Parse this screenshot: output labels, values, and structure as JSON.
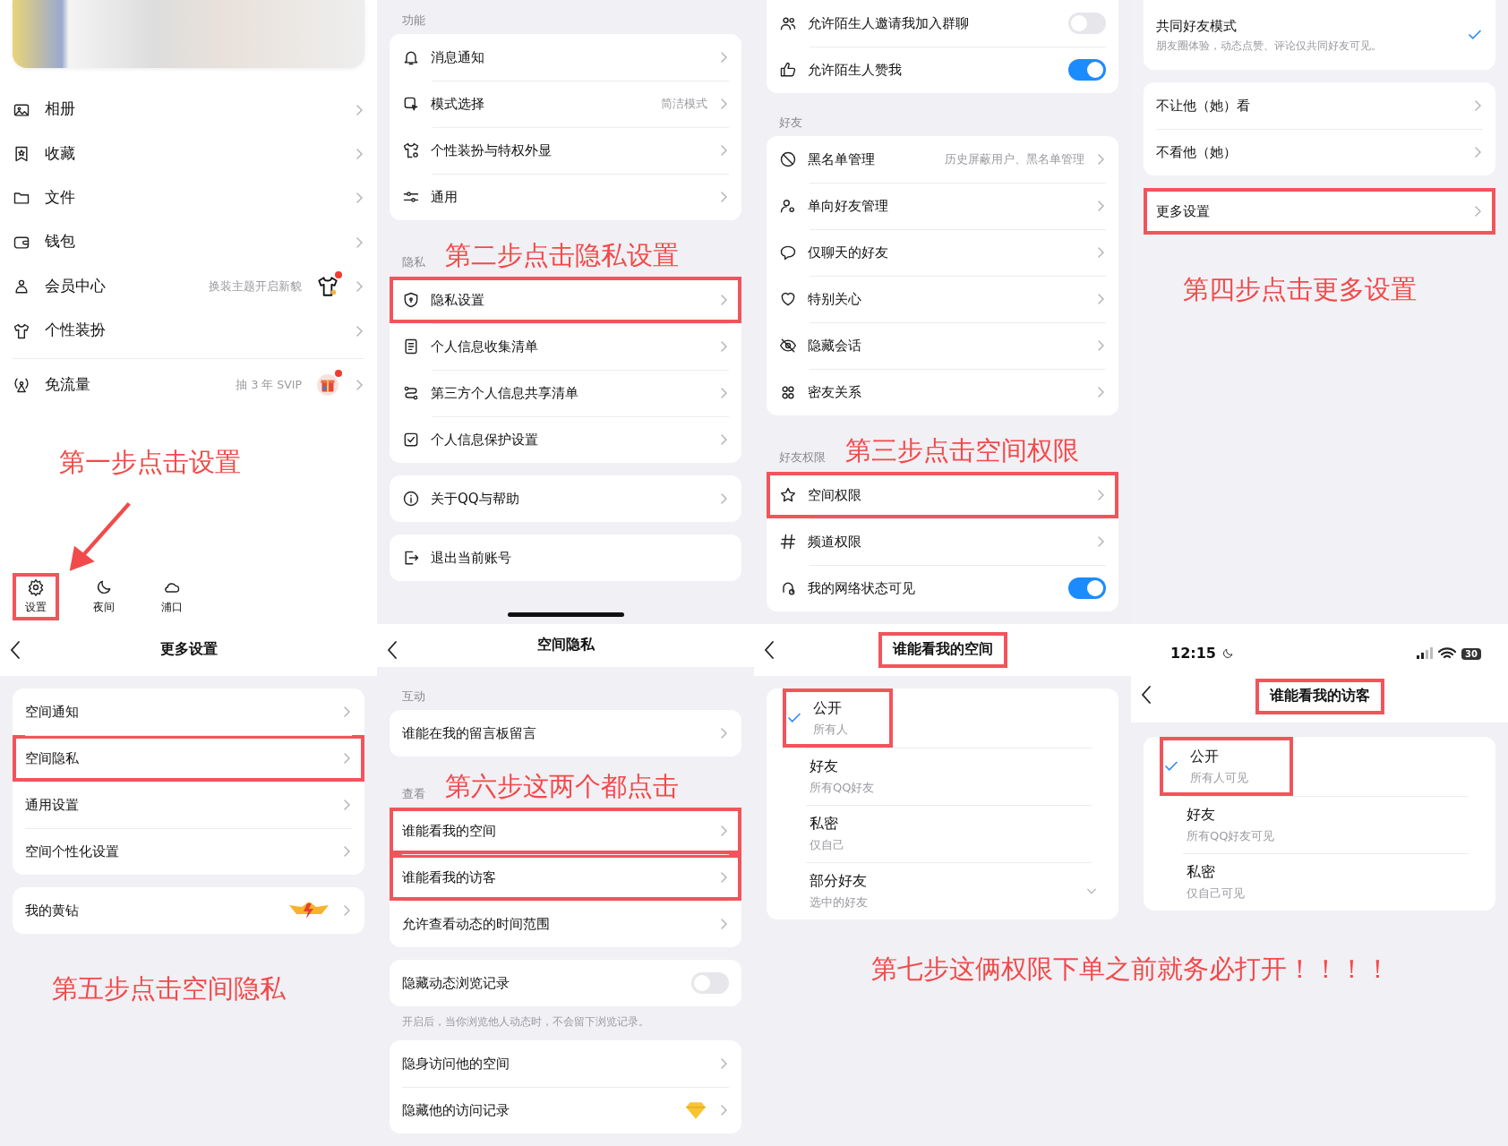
{
  "panels": [
    {
      "blocks": [
        {
          "kind": "profile"
        },
        {
          "kind": "menu",
          "items": [
            {
              "label": "相册"
            },
            {
              "label": "收藏"
            },
            {
              "label": "文件"
            },
            {
              "label": "钱包"
            },
            {
              "label": "会员中心",
              "value": "换装主题开启新貌",
              "badge": true,
              "notify": true
            },
            {
              "label": "个性装扮"
            },
            {
              "label": "免流量",
              "value": "抽 3 年 SVIP",
              "badge": true,
              "notify": true,
              "divider_before": true
            }
          ]
        },
        {
          "kind": "annotation",
          "text": "第一步点击设置",
          "arrow": true
        },
        {
          "kind": "bottom_bar",
          "items": [
            {
              "label": "设置",
              "highlighted": true
            },
            {
              "label": "夜间",
              "highlighted": false
            },
            {
              "label": "浦口",
              "highlighted": false
            }
          ]
        }
      ]
    },
    {
      "blocks": [
        {
          "kind": "section_label",
          "text": "功能"
        },
        {
          "kind": "card",
          "items": [
            {
              "label": "消息通知",
              "kind": "chevron"
            },
            {
              "label": "模式选择",
              "value": "简洁模式",
              "kind": "chevron"
            },
            {
              "label": "个性装扮与特权外显",
              "kind": "chevron"
            },
            {
              "label": "通用",
              "kind": "chevron"
            }
          ]
        },
        {
          "kind": "section_label",
          "text": "隐私",
          "annotation": "第二步点击隐私设置"
        },
        {
          "kind": "card",
          "items": [
            {
              "label": "隐私设置",
              "kind": "chevron",
              "highlighted": true
            },
            {
              "label": "个人信息收集清单",
              "kind": "chevron",
              "highlighted": false
            },
            {
              "label": "第三方个人信息共享清单",
              "kind": "chevron",
              "highlighted": false
            },
            {
              "label": "个人信息保护设置",
              "kind": "chevron",
              "highlighted": false
            }
          ]
        },
        {
          "kind": "card",
          "items": [
            {
              "label": "关于QQ与帮助",
              "kind": "chevron"
            }
          ]
        },
        {
          "kind": "card",
          "items": [
            {
              "label": "退出当前账号",
              "kind": "plain"
            }
          ]
        },
        {
          "kind": "home_indicator"
        }
      ]
    },
    {
      "blocks": [
        {
          "kind": "card",
          "items": [
            {
              "label": "允许陌生人邀请我加入群聊",
              "kind": "toggle",
              "on": false
            },
            {
              "label": "允许陌生人赞我",
              "kind": "toggle",
              "on": true
            }
          ]
        },
        {
          "kind": "section_label",
          "text": "好友"
        },
        {
          "kind": "card",
          "items": [
            {
              "label": "黑名单管理",
              "value": "历史屏蔽用户、黑名单管理",
              "kind": "chevron"
            },
            {
              "label": "单向好友管理",
              "kind": "chevron"
            },
            {
              "label": "仅聊天的好友",
              "kind": "chevron"
            },
            {
              "label": "特别关心",
              "kind": "chevron"
            },
            {
              "label": "隐藏会话",
              "kind": "chevron"
            },
            {
              "label": "密友关系",
              "kind": "chevron"
            }
          ]
        },
        {
          "kind": "section_label",
          "text": "好友权限",
          "annotation": "第三步点击空间权限"
        },
        {
          "kind": "card",
          "items": [
            {
              "label": "空间权限",
              "kind": "chevron",
              "highlighted": true
            },
            {
              "label": "频道权限",
              "kind": "chevron",
              "highlighted": false
            },
            {
              "label": "我的网络状态可见",
              "kind": "toggle",
              "on": true,
              "highlighted": false
            }
          ]
        }
      ]
    },
    {
      "blocks": [
        {
          "kind": "card",
          "items": [
            {
              "label": "共同好友模式",
              "subtitle": "朋友圈体验，动态点赞、评论仅共同好友可见。",
              "kind": "check",
              "selected": true
            }
          ]
        },
        {
          "kind": "card",
          "items": [
            {
              "label": "不让他（她）看",
              "kind": "chevron"
            },
            {
              "label": "不看他（她）",
              "kind": "chevron"
            }
          ]
        },
        {
          "kind": "card",
          "items": [
            {
              "label": "更多设置",
              "kind": "chevron",
              "highlighted": true
            }
          ]
        },
        {
          "kind": "annotation",
          "text": "第四步点击更多设置"
        }
      ]
    },
    {
      "blocks": [
        {
          "kind": "nav",
          "title": "更多设置"
        },
        {
          "kind": "card",
          "items": [
            {
              "label": "空间通知",
              "kind": "chevron",
              "highlighted": false
            },
            {
              "label": "空间隐私",
              "kind": "chevron",
              "highlighted": true
            },
            {
              "label": "通用设置",
              "kind": "chevron",
              "highlighted": false
            },
            {
              "label": "空间个性化设置",
              "kind": "chevron",
              "highlighted": false
            }
          ]
        },
        {
          "kind": "card",
          "items": [
            {
              "label": "我的黄钻",
              "badge": true,
              "kind": "chevron"
            }
          ]
        },
        {
          "kind": "annotation",
          "text": "第五步点击空间隐私"
        }
      ]
    },
    {
      "blocks": [
        {
          "kind": "nav",
          "title": "空间隐私"
        },
        {
          "kind": "section_label",
          "text": "互动"
        },
        {
          "kind": "card",
          "items": [
            {
              "label": "谁能在我的留言板留言",
              "kind": "chevron"
            }
          ]
        },
        {
          "kind": "section_label",
          "text": "查看",
          "annotation": "第六步这两个都点击"
        },
        {
          "kind": "card",
          "items": [
            {
              "label": "谁能看我的空间",
              "kind": "chevron",
              "highlighted": true
            },
            {
              "label": "谁能看我的访客",
              "kind": "chevron",
              "highlighted": true
            },
            {
              "label": "允许查看动态的时间范围",
              "kind": "chevron",
              "highlighted": false
            }
          ]
        },
        {
          "kind": "card",
          "items": [
            {
              "label": "隐藏动态浏览记录",
              "kind": "toggle",
              "on": false
            }
          ]
        },
        {
          "kind": "note",
          "text": "开启后，当你浏览他人动态时，不会留下浏览记录。"
        },
        {
          "kind": "card",
          "items": [
            {
              "label": "隐身访问他的空间",
              "kind": "chevron"
            },
            {
              "label": "隐藏他的访问记录",
              "badge": true,
              "kind": "chevron"
            }
          ]
        }
      ]
    },
    {
      "blocks": [
        {
          "kind": "nav",
          "title": "谁能看我的空间",
          "title_highlighted": true
        },
        {
          "kind": "options",
          "items": [
            {
              "label": "公开",
              "subtitle": "所有人",
              "kind": "check",
              "selected": true,
              "highlighted": true
            },
            {
              "label": "好友",
              "subtitle": "所有QQ好友",
              "kind": "check",
              "selected": false,
              "highlighted": false
            },
            {
              "label": "私密",
              "subtitle": "仅自己",
              "kind": "check",
              "selected": false,
              "highlighted": false
            },
            {
              "label": "部分好友",
              "subtitle": "选中的好友",
              "kind": "dropdown",
              "selected": false,
              "highlighted": false
            }
          ]
        }
      ]
    },
    {
      "blocks": [
        {
          "kind": "status",
          "time": "12:15",
          "battery": "30"
        },
        {
          "kind": "nav",
          "title": "谁能看我的访客",
          "title_highlighted": true
        },
        {
          "kind": "options",
          "items": [
            {
              "label": "公开",
              "subtitle": "所有人可见",
              "kind": "check",
              "selected": true,
              "highlighted": true
            },
            {
              "label": "好友",
              "subtitle": "所有QQ好友可见",
              "kind": "check",
              "selected": false,
              "highlighted": false
            },
            {
              "label": "私密",
              "subtitle": "仅自己可见",
              "kind": "check",
              "selected": false,
              "highlighted": false
            }
          ]
        }
      ]
    }
  ],
  "shared_annotation": {
    "text": "第七步这俩权限下单之前就务必打开！！！！"
  }
}
